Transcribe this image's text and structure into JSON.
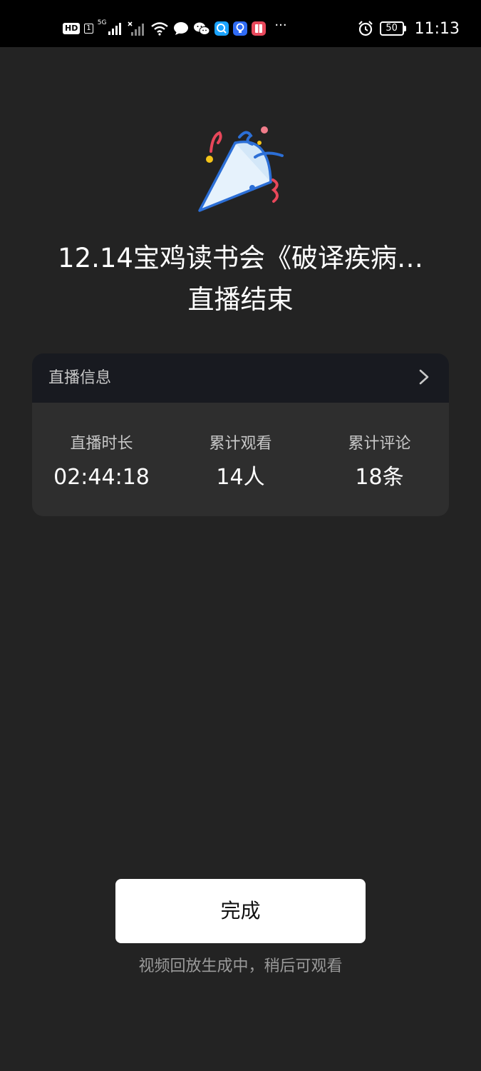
{
  "status_bar": {
    "hd_label": "HD",
    "sim_label": "1",
    "network_label": "5G",
    "more_label": "···",
    "battery_level": "50",
    "time": "11:13",
    "app_icons": [
      "chat-bubble-icon",
      "wechat-icon",
      "search-app-icon",
      "bulb-app-icon",
      "book-app-icon"
    ]
  },
  "header": {
    "icon": "party-popper-icon",
    "title_line1": "12.14宝鸡读书会《破译疾病…",
    "title_line2": "直播结束"
  },
  "info_card": {
    "title": "直播信息",
    "chevron_icon": "chevron-right-icon",
    "stats": [
      {
        "label": "直播时长",
        "value": "02:44:18"
      },
      {
        "label": "累计观看",
        "value": "14人"
      },
      {
        "label": "累计评论",
        "value": "18条"
      }
    ]
  },
  "footer": {
    "done_label": "完成",
    "note": "视频回放生成中，稍后可观看"
  },
  "colors": {
    "background": "#232323",
    "card_header": "#181a20",
    "card_body": "#2e2e2e",
    "button": "#ffffff",
    "note_text": "#9a9a9a"
  }
}
